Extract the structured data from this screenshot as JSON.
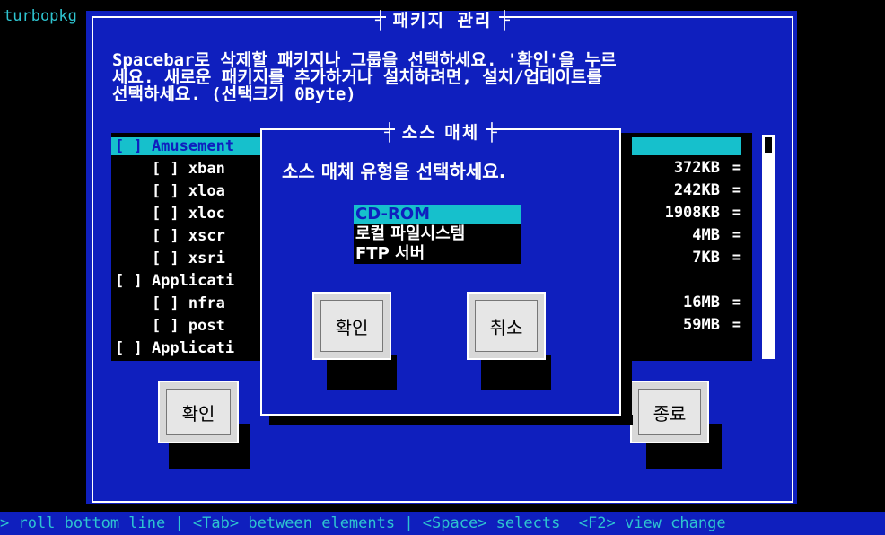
{
  "app_label": "turbopkg",
  "main": {
    "title": "패키지 관리",
    "instructions": "Spacebar로 삭제할 패키지나 그룹을 선택하세요. '확인'을 누르\n세요. 새로운 패키지를 추가하거나 설치하려면, 설치/업데이트를\n선택하세요. (선택크기 0Byte)",
    "rows": [
      {
        "label": "[ ] Amusement",
        "size": "",
        "sep": ""
      },
      {
        "label": "    [ ] xban",
        "size": "372KB",
        "sep": "="
      },
      {
        "label": "    [ ] xloa",
        "size": "242KB",
        "sep": "="
      },
      {
        "label": "    [ ] xloc",
        "size": "1908KB",
        "sep": "="
      },
      {
        "label": "    [ ] xscr",
        "size": "4MB",
        "sep": "="
      },
      {
        "label": "    [ ] xsri",
        "size": "7KB",
        "sep": "="
      },
      {
        "label": "[ ] Applicati",
        "size": "",
        "sep": ""
      },
      {
        "label": "    [ ] nfra",
        "size": "16MB",
        "sep": "="
      },
      {
        "label": "    [ ] post",
        "size": "59MB",
        "sep": "="
      },
      {
        "label": "[ ] Applicati",
        "size": "",
        "sep": ""
      }
    ],
    "ok_label": "확인",
    "exit_label": "종료"
  },
  "dialog": {
    "title": "소스 매체",
    "prompt": "소스 매체 유형을 선택하세요.",
    "options": [
      "CD-ROM",
      "로컬 파일시스템",
      "FTP 서버"
    ],
    "ok_label": "확인",
    "cancel_label": "취소"
  },
  "status_bar": "> roll bottom line | <Tab> between elements | <Space> selects  <F2> view change"
}
